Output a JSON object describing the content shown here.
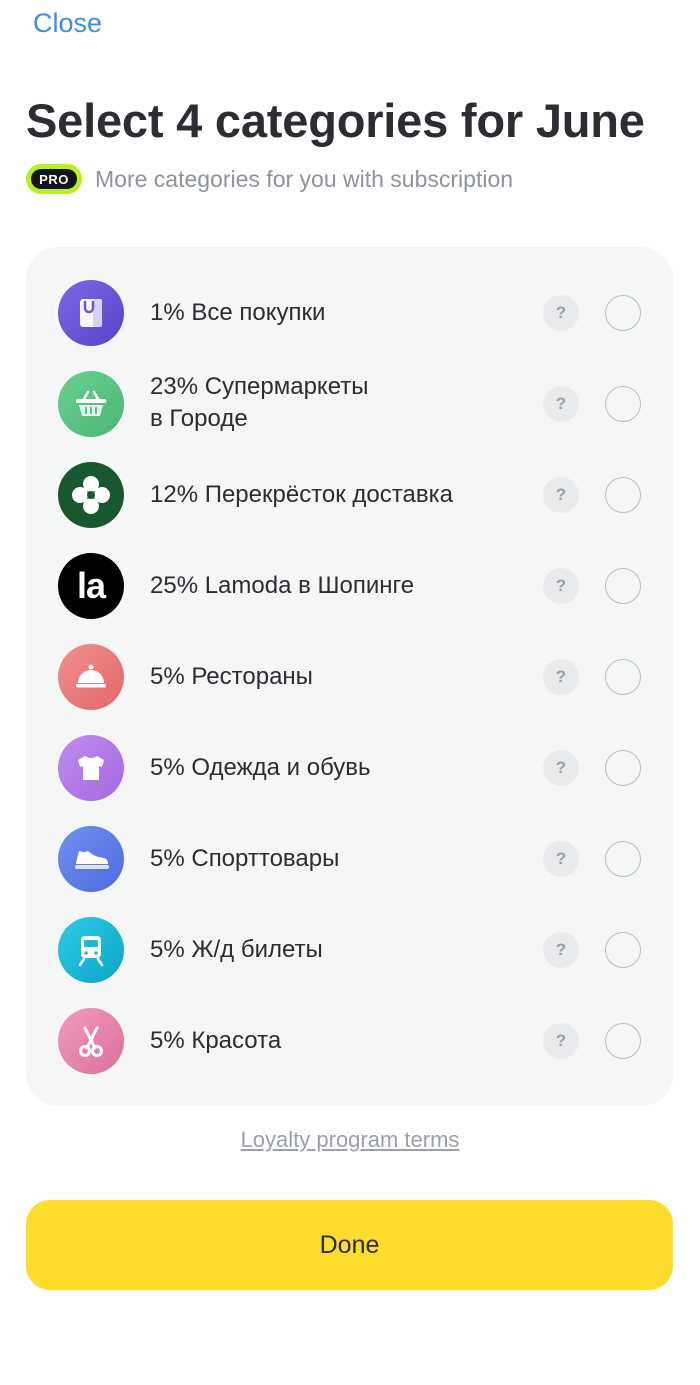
{
  "header": {
    "close_label": "Close",
    "title": "Select 4 categories for June",
    "pro_badge": "PRO",
    "subtitle": "More categories for you with subscription"
  },
  "categories": [
    {
      "label": "1% Все покупки",
      "icon": "shopping-bag-icon",
      "color": "#6c56d9"
    },
    {
      "label": "23% Супермаркеты\nв Городе",
      "icon": "basket-icon",
      "color": "#5cc483"
    },
    {
      "label": "12% Перекрёсток доставка",
      "icon": "perekrestok-logo-icon",
      "color": "#17582f"
    },
    {
      "label": "25% Lamoda в Шопинге",
      "icon": "lamoda-logo-icon",
      "color": "#000000",
      "logo_text": "la"
    },
    {
      "label": "5% Рестораны",
      "icon": "cloche-icon",
      "color": "#ec7a7a"
    },
    {
      "label": "5% Одежда и обувь",
      "icon": "tshirt-icon",
      "color": "#b27ae6"
    },
    {
      "label": "5% Спорттовары",
      "icon": "sneaker-icon",
      "color": "#5b7ee8"
    },
    {
      "label": "5% Ж/д билеты",
      "icon": "train-icon",
      "color": "#1ab9d8"
    },
    {
      "label": "5% Красота",
      "icon": "scissors-icon",
      "color": "#e882ad"
    }
  ],
  "help_symbol": "?",
  "footer": {
    "terms_label": "Loyalty program terms",
    "done_label": "Done"
  }
}
